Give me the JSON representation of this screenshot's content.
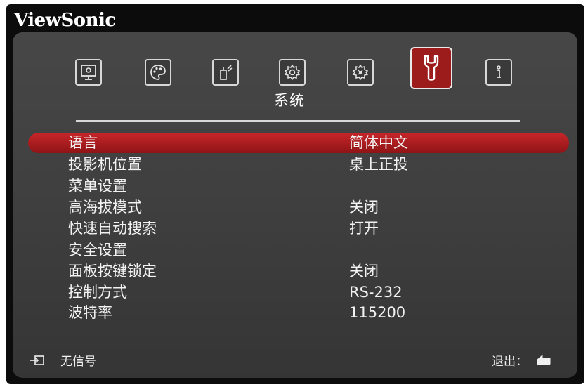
{
  "brand": "ViewSonic",
  "tabs": [
    {
      "icon": "display-icon",
      "active": false
    },
    {
      "icon": "palette-icon",
      "active": false
    },
    {
      "icon": "audio-icon",
      "active": false
    },
    {
      "icon": "settings-gear-icon",
      "active": false
    },
    {
      "icon": "advanced-gear-icon",
      "active": false
    },
    {
      "icon": "wrench-icon",
      "active": true
    },
    {
      "icon": "info-icon",
      "active": false
    }
  ],
  "active_tab_title": "系统",
  "menu": [
    {
      "label": "语言",
      "value": "简体中文",
      "selected": true
    },
    {
      "label": "投影机位置",
      "value": "桌上正投",
      "selected": false
    },
    {
      "label": "菜单设置",
      "value": "",
      "selected": false
    },
    {
      "label": "高海拔模式",
      "value": "关闭",
      "selected": false
    },
    {
      "label": "快速自动搜索",
      "value": "打开",
      "selected": false
    },
    {
      "label": "安全设置",
      "value": "",
      "selected": false
    },
    {
      "label": "面板按键锁定",
      "value": "关闭",
      "selected": false
    },
    {
      "label": "控制方式",
      "value": "RS-232",
      "selected": false
    },
    {
      "label": "波特率",
      "value": "115200",
      "selected": false
    }
  ],
  "footer": {
    "source_icon": "input-source-icon",
    "source_status": "无信号",
    "exit_label": "退出：",
    "exit_icon": "return-arrow-icon"
  },
  "colors": {
    "selection": "#b71f23",
    "active_tab": "#9c1c1c",
    "panel": "#424242",
    "frame": "#0c0c0c"
  }
}
